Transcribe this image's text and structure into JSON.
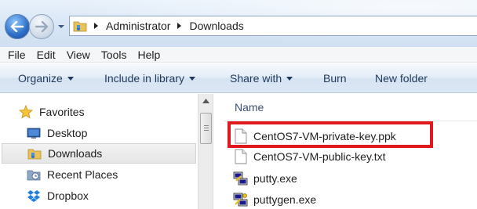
{
  "address_bar": {
    "crumbs": [
      "Administrator",
      "Downloads"
    ]
  },
  "menu": {
    "items": [
      "File",
      "Edit",
      "View",
      "Tools",
      "Help"
    ]
  },
  "commands": {
    "organize": "Organize",
    "include_in_library": "Include in library",
    "share_with": "Share with",
    "burn": "Burn",
    "new_folder": "New folder"
  },
  "nav_pane": {
    "favorites_label": "Favorites",
    "items": [
      {
        "label": "Desktop",
        "icon": "desktop-icon"
      },
      {
        "label": "Downloads",
        "icon": "downloads-folder-icon",
        "selected": true
      },
      {
        "label": "Recent Places",
        "icon": "recent-places-icon"
      },
      {
        "label": "Dropbox",
        "icon": "dropbox-icon"
      }
    ]
  },
  "file_list": {
    "column_name": "Name",
    "files": [
      {
        "name": "CentOS7-VM-private-key.ppk",
        "icon": "document-icon",
        "highlighted": true
      },
      {
        "name": "CentOS7-VM-public-key.txt",
        "icon": "document-icon"
      },
      {
        "name": "putty.exe",
        "icon": "putty-icon"
      },
      {
        "name": "puttygen.exe",
        "icon": "puttygen-icon"
      }
    ]
  },
  "colors": {
    "highlight": "#e0191e",
    "command_text": "#1e395b",
    "column_header_text": "#3b4e6e"
  }
}
